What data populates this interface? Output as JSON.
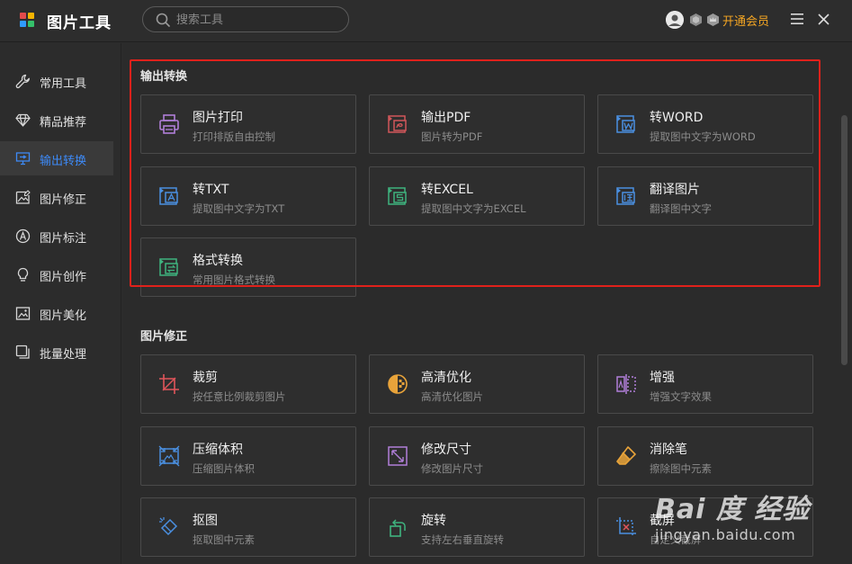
{
  "app": {
    "title": "图片工具",
    "search_placeholder": "搜索工具",
    "vip_label": "开通会员",
    "colors": {
      "accent": "#3d8af7",
      "vip": "#f5a623",
      "highlight": "#e0211b"
    }
  },
  "sidebar": {
    "items": [
      {
        "label": "常用工具",
        "icon": "wrench-icon"
      },
      {
        "label": "精品推荐",
        "icon": "diamond-icon"
      },
      {
        "label": "输出转换",
        "icon": "export-icon",
        "active": true
      },
      {
        "label": "图片修正",
        "icon": "image-edit-icon"
      },
      {
        "label": "图片标注",
        "icon": "annotate-icon"
      },
      {
        "label": "图片创作",
        "icon": "bulb-icon"
      },
      {
        "label": "图片美化",
        "icon": "beautify-icon"
      },
      {
        "label": "批量处理",
        "icon": "batch-icon"
      }
    ]
  },
  "sections": [
    {
      "title": "输出转换",
      "cards": [
        {
          "title": "图片打印",
          "subtitle": "打印排版自由控制",
          "icon": "printer-icon"
        },
        {
          "title": "输出PDF",
          "subtitle": "图片转为PDF",
          "icon": "pdf-icon"
        },
        {
          "title": "转WORD",
          "subtitle": "提取图中文字为WORD",
          "icon": "word-icon"
        },
        {
          "title": "转TXT",
          "subtitle": "提取图中文字为TXT",
          "icon": "txt-icon"
        },
        {
          "title": "转EXCEL",
          "subtitle": "提取图中文字为EXCEL",
          "icon": "excel-icon"
        },
        {
          "title": "翻译图片",
          "subtitle": "翻译图中文字",
          "icon": "translate-icon"
        },
        {
          "title": "格式转换",
          "subtitle": "常用图片格式转换",
          "icon": "format-convert-icon"
        }
      ]
    },
    {
      "title": "图片修正",
      "cards": [
        {
          "title": "裁剪",
          "subtitle": "按任意比例裁剪图片",
          "icon": "crop-icon"
        },
        {
          "title": "高清优化",
          "subtitle": "高清优化图片",
          "icon": "hd-icon"
        },
        {
          "title": "增强",
          "subtitle": "增强文字效果",
          "icon": "enhance-icon"
        },
        {
          "title": "压缩体积",
          "subtitle": "压缩图片体积",
          "icon": "compress-icon"
        },
        {
          "title": "修改尺寸",
          "subtitle": "修改图片尺寸",
          "icon": "resize-icon"
        },
        {
          "title": "消除笔",
          "subtitle": "擦除图中元素",
          "icon": "eraser-icon"
        },
        {
          "title": "抠图",
          "subtitle": "抠取图中元素",
          "icon": "cutout-icon"
        },
        {
          "title": "旋转",
          "subtitle": "支持左右垂直旋转",
          "icon": "rotate-icon"
        },
        {
          "title": "截屏",
          "subtitle": "自定义截屏",
          "icon": "screenshot-icon"
        }
      ]
    }
  ],
  "watermark": {
    "logo": "Bai 度 经验",
    "url": "jingyan.baidu.com"
  }
}
